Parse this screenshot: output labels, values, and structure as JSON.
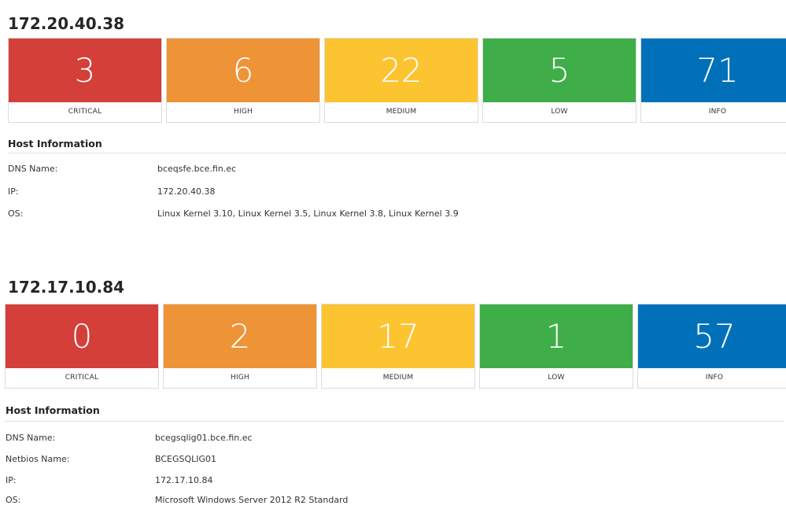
{
  "severity_labels": [
    "CRITICAL",
    "HIGH",
    "MEDIUM",
    "LOW",
    "INFO"
  ],
  "colors": {
    "critical": "#d43f3a",
    "high": "#ee9336",
    "medium": "#fdc431",
    "low": "#3fae49",
    "info": "#0071b9"
  },
  "hosts": [
    {
      "title": "172.20.40.38",
      "counts": {
        "critical": "3",
        "high": "6",
        "medium": "22",
        "low": "5",
        "info": "71"
      },
      "info_title": "Host Information",
      "info": [
        {
          "key": "DNS Name:",
          "value": "bceqsfe.bce.fin.ec"
        },
        {
          "key": "IP:",
          "value": "172.20.40.38"
        },
        {
          "key": "OS:",
          "value": "Linux Kernel 3.10, Linux Kernel 3.5, Linux Kernel 3.8, Linux Kernel 3.9"
        }
      ]
    },
    {
      "title": "172.17.10.84",
      "counts": {
        "critical": "0",
        "high": "2",
        "medium": "17",
        "low": "1",
        "info": "57"
      },
      "info_title": "Host Information",
      "info": [
        {
          "key": "DNS Name:",
          "value": "bcegsqlig01.bce.fin.ec"
        },
        {
          "key": "Netbios Name:",
          "value": "BCEGSQLIG01"
        },
        {
          "key": "IP:",
          "value": "172.17.10.84"
        },
        {
          "key": "OS:",
          "value": "Microsoft Windows Server 2012 R2 Standard"
        }
      ]
    }
  ]
}
